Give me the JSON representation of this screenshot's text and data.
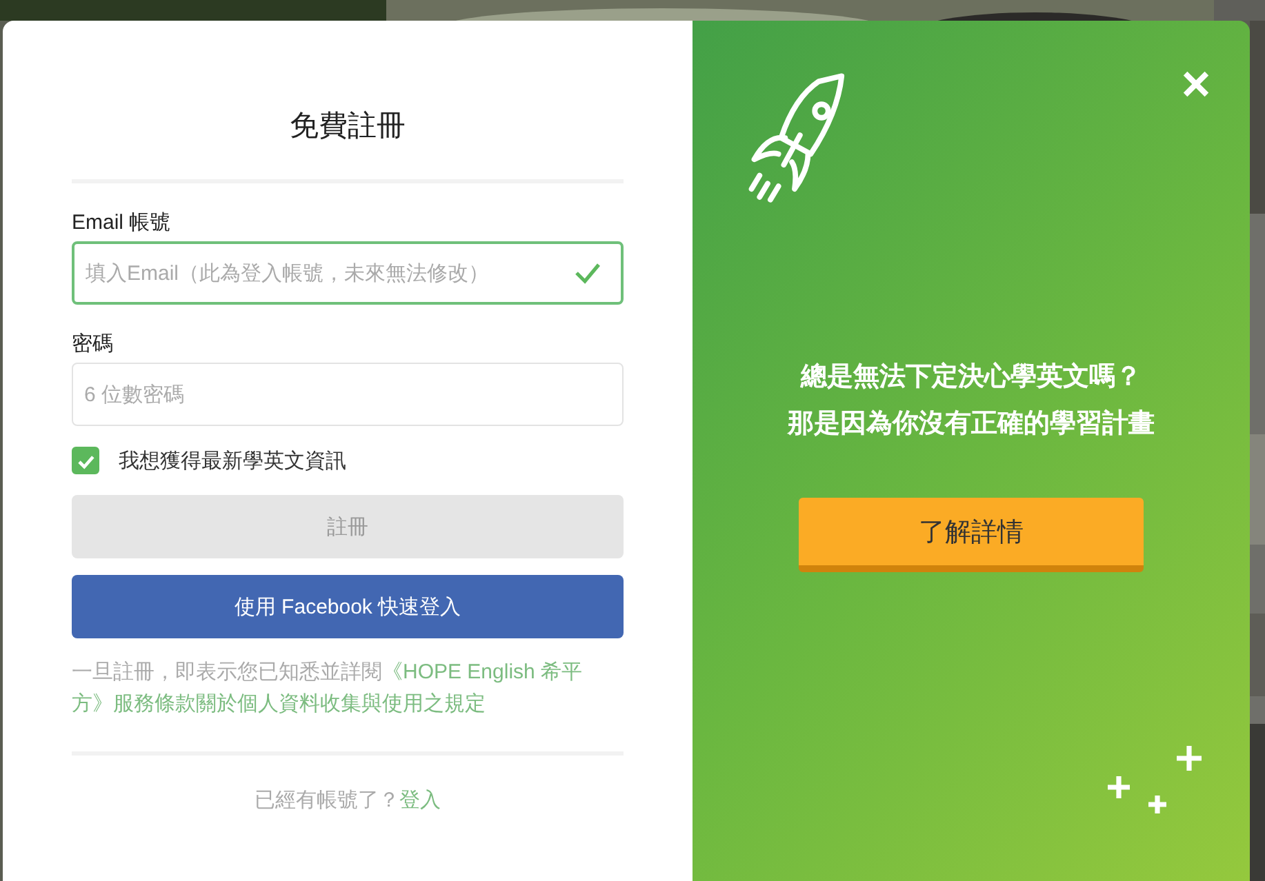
{
  "signup": {
    "title": "免費註冊",
    "email": {
      "label": "Email 帳號",
      "placeholder": "填入Email（此為登入帳號，未來無法修改）",
      "valid": true
    },
    "password": {
      "label": "密碼",
      "placeholder": "6 位數密碼"
    },
    "newsletter": {
      "label": "我想獲得最新學英文資訊",
      "checked": true
    },
    "register_button": {
      "label": "註冊",
      "disabled": true
    },
    "facebook_button": {
      "label": "使用 Facebook 快速登入"
    },
    "terms": {
      "text": "一旦註冊，即表示您已知悉並詳閱",
      "link": "《HOPE English 希平方》服務條款關於個人資料收集與使用之規定"
    },
    "login_prompt": {
      "text": "已經有帳號了？",
      "link": "登入"
    }
  },
  "promo": {
    "lines": [
      "總是無法下定決心學英文嗎？",
      "那是因為你沒有正確的學習計畫"
    ],
    "button": "了解詳情"
  }
}
